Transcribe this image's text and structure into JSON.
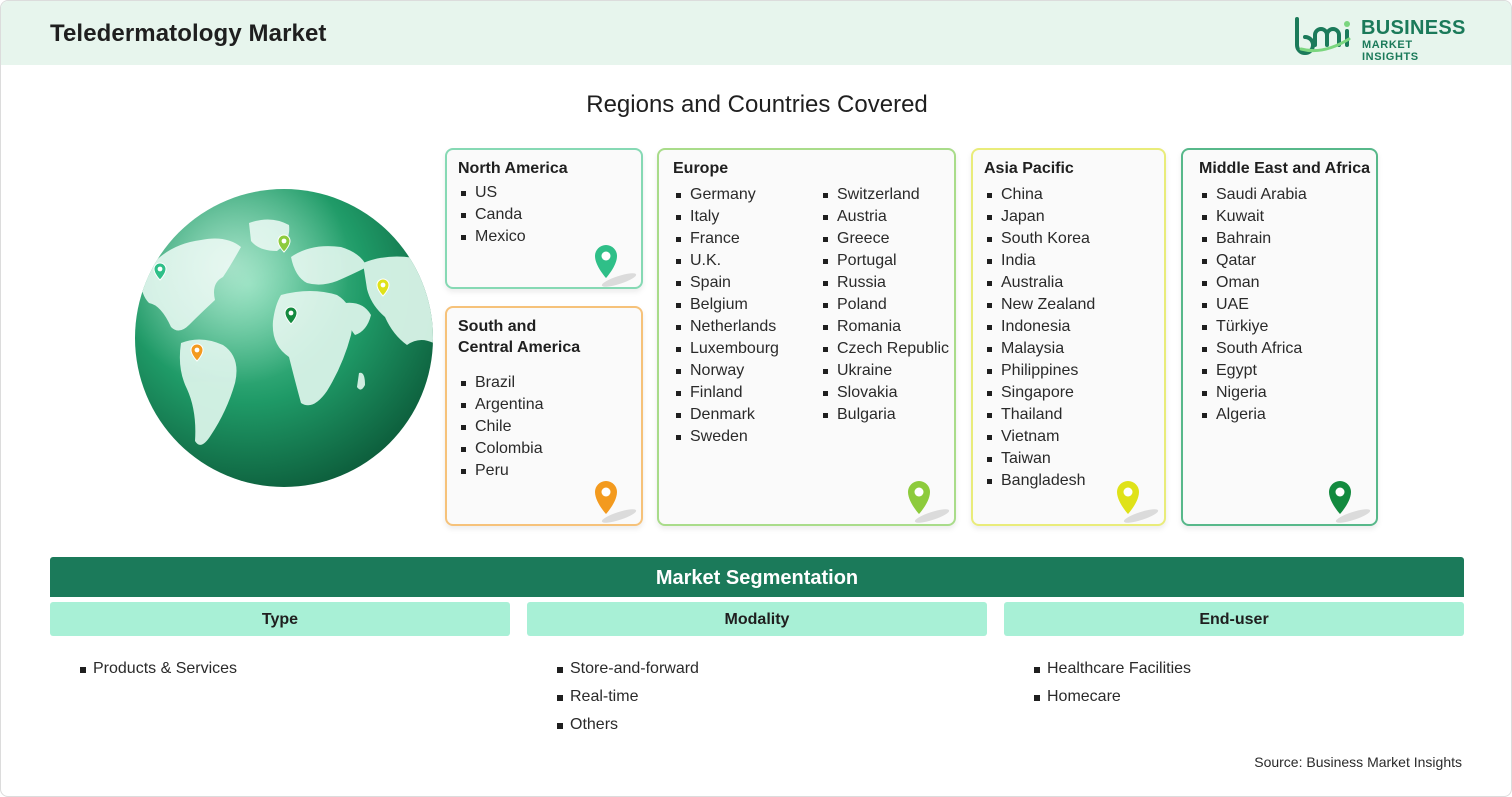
{
  "header": {
    "title": "Teledermatology Market",
    "logo_line1": "BUSINESS",
    "logo_line2": "MARKET INSIGHTS"
  },
  "regions_title": "Regions and Countries Covered",
  "regions": {
    "north_america": {
      "title": "North America",
      "items": [
        "US",
        "Canda",
        "Mexico"
      ],
      "color": "#7fd6b0"
    },
    "south_central_america": {
      "title_line1": "South and",
      "title_line2": "Central America",
      "items": [
        "Brazil",
        "Argentina",
        "Chile",
        "Colombia",
        "Peru"
      ],
      "color": "#f6c27a"
    },
    "europe": {
      "title": "Europe",
      "col1": [
        "Germany",
        "Italy",
        "France",
        "U.K.",
        "Spain",
        "Belgium",
        "Netherlands",
        "Luxembourg",
        "Norway",
        "Finland",
        "Denmark",
        "Sweden"
      ],
      "col2": [
        "Switzerland",
        "Austria",
        "Greece",
        "Portugal",
        "Russia",
        "Poland",
        "Romania",
        "Czech Republic",
        "Ukraine",
        "Slovakia",
        "Bulgaria"
      ],
      "color": "#a9dc8a"
    },
    "asia_pacific": {
      "title": "Asia Pacific",
      "items": [
        "China",
        "Japan",
        "South Korea",
        "India",
        "Australia",
        "New Zealand",
        "Indonesia",
        "Malaysia",
        "Philippines",
        "Singapore",
        "Thailand",
        "Vietnam",
        "Taiwan",
        "Bangladesh"
      ],
      "color": "#e9ec7a"
    },
    "middle_east_africa": {
      "title": "Middle East and Africa",
      "items": [
        "Saudi Arabia",
        "Kuwait",
        "Bahrain",
        "Qatar",
        "Oman",
        "UAE",
        "Türkiye",
        "South Africa",
        "Egypt",
        "Nigeria",
        "Algeria"
      ],
      "color": "#57b88a"
    }
  },
  "segmentation": {
    "title": "Market Segmentation",
    "columns": [
      {
        "label": "Type",
        "items": [
          "Products & Services"
        ]
      },
      {
        "label": "Modality",
        "items": [
          "Store-and-forward",
          "Real-time",
          "Others"
        ]
      },
      {
        "label": "End-user",
        "items": [
          "Healthcare Facilities",
          "Homecare"
        ]
      }
    ]
  },
  "source": "Source: Business Market Insights",
  "colors": {
    "brand": "#1b7a5a",
    "header_bg": "#e7f5ed",
    "segment_header": "#a8f0d6",
    "pin_na": "#2fbf88",
    "pin_sa": "#f39a1e",
    "pin_eu": "#8dcb3c",
    "pin_ap": "#dfe219",
    "pin_mea": "#138a3f"
  },
  "icons": [
    "globe-icon",
    "location-pin-icon",
    "bmi-logo-icon"
  ]
}
